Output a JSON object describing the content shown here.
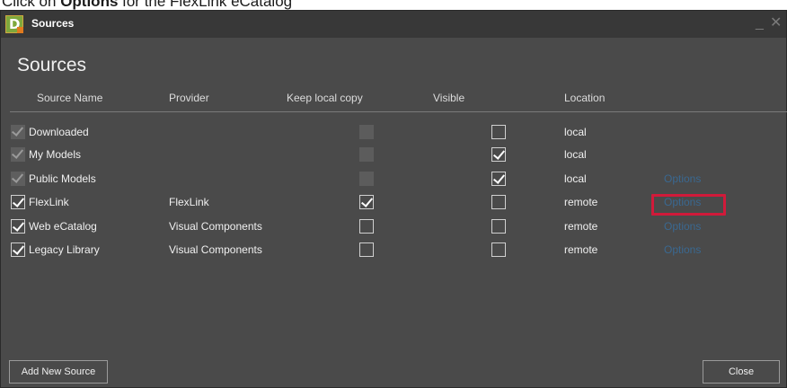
{
  "instruction": {
    "prefix": "Click on ",
    "bold": "Options",
    "suffix": " for the FlexLink eCatalog"
  },
  "window": {
    "title": "Sources",
    "minimize_glyph": "_",
    "close_glyph": "✕",
    "app_icon_letter": "D"
  },
  "heading": "Sources",
  "columns": {
    "name": "Source Name",
    "provider": "Provider",
    "keep_local": "Keep local copy",
    "visible": "Visible",
    "location": "Location"
  },
  "rows": [
    {
      "name": "Downloaded",
      "provider": "",
      "keep_local": "disabled",
      "visible": false,
      "location": "local",
      "options": "",
      "enabled_checked": true,
      "enabled_disabled": true
    },
    {
      "name": "My Models",
      "provider": "",
      "keep_local": "disabled",
      "visible": true,
      "location": "local",
      "options": "",
      "enabled_checked": true,
      "enabled_disabled": true
    },
    {
      "name": "Public Models",
      "provider": "",
      "keep_local": "disabled",
      "visible": true,
      "location": "local",
      "options": "Options",
      "enabled_checked": true,
      "enabled_disabled": true
    },
    {
      "name": "FlexLink",
      "provider": "FlexLink",
      "keep_local": true,
      "visible": false,
      "location": "remote",
      "options": "Options",
      "enabled_checked": true,
      "enabled_disabled": false
    },
    {
      "name": "Web eCatalog",
      "provider": "Visual Components",
      "keep_local": false,
      "visible": false,
      "location": "remote",
      "options": "Options",
      "enabled_checked": true,
      "enabled_disabled": false
    },
    {
      "name": "Legacy Library",
      "provider": "Visual Components",
      "keep_local": false,
      "visible": false,
      "location": "remote",
      "options": "Options",
      "enabled_checked": true,
      "enabled_disabled": false
    }
  ],
  "buttons": {
    "add_new_source": "Add New Source",
    "close": "Close"
  },
  "colors": {
    "window_bg": "#4a4a4a",
    "titlebar_bg": "#383838",
    "options_link": "#3a6890",
    "highlight": "#d11a3a"
  }
}
